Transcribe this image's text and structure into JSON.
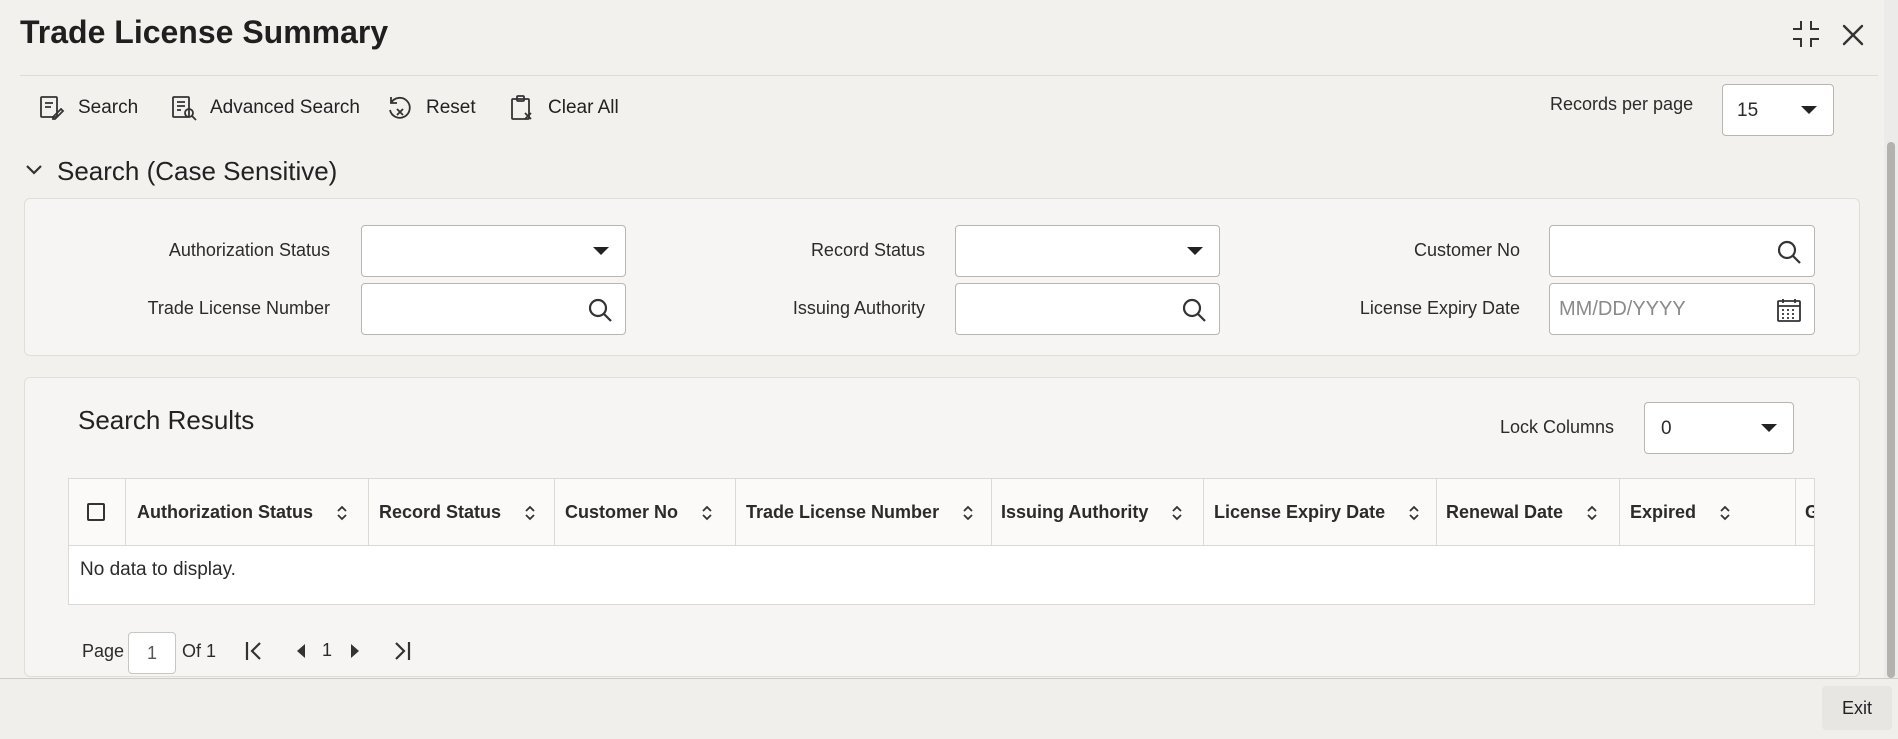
{
  "window": {
    "title": "Trade License Summary"
  },
  "toolbar": {
    "search": "Search",
    "advanced_search": "Advanced Search",
    "reset": "Reset",
    "clear_all": "Clear All",
    "records_per_page_label": "Records per page",
    "records_per_page_value": "15"
  },
  "search_section": {
    "title": "Search (Case Sensitive)",
    "fields": {
      "authorization_status": "Authorization Status",
      "record_status": "Record Status",
      "customer_no": "Customer No",
      "trade_license_number": "Trade License Number",
      "issuing_authority": "Issuing Authority",
      "license_expiry_date": "License Expiry Date",
      "license_expiry_placeholder": "MM/DD/YYYY"
    }
  },
  "results": {
    "title": "Search Results",
    "lock_columns_label": "Lock Columns",
    "lock_columns_value": "0",
    "columns": [
      "Authorization Status",
      "Record Status",
      "Customer No",
      "Trade License Number",
      "Issuing Authority",
      "License Expiry Date",
      "Renewal Date",
      "Expired",
      "G"
    ],
    "empty_message": "No data to display."
  },
  "pagination": {
    "page_label": "Page",
    "page_value": "1",
    "of_label": "Of 1",
    "current_page": "1"
  },
  "footer": {
    "exit": "Exit"
  }
}
